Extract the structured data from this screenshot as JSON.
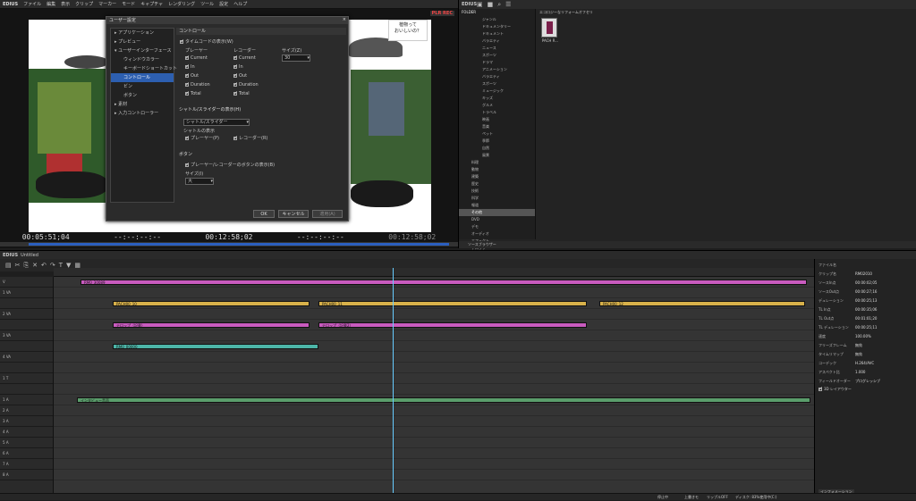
{
  "menu": {
    "brand": "EDIUS",
    "items": [
      "ファイル",
      "編集",
      "表示",
      "クリップ",
      "マーカー",
      "モード",
      "キャプチャ",
      "レンダリング",
      "ツール",
      "設定",
      "ヘルプ"
    ],
    "plrec": "PLR REC"
  },
  "preview": {
    "tc_left": "00:05:51;04",
    "tc_mid1": "--:--:--:--",
    "tc_mid2": "00:12:58;02",
    "tc_mid3": "--:--:--:--",
    "tc_right": "00:12:58;02",
    "logo_line1": "植物って",
    "logo_line2": "おいしいの？"
  },
  "transport": [
    "⏮",
    "■",
    "◀◀",
    "◀",
    "▶",
    "▶",
    "▶▶",
    "⏭"
  ],
  "dialog": {
    "title": "ユーザー設定",
    "close": "×",
    "tree": [
      {
        "label": "▸ アプリケーション",
        "sub": false,
        "sel": false
      },
      {
        "label": "▸ プレビュー",
        "sub": false,
        "sel": false
      },
      {
        "label": "▾ ユーザーインターフェース",
        "sub": false,
        "sel": false
      },
      {
        "label": "ウィンドウカラー",
        "sub": true,
        "sel": false
      },
      {
        "label": "キーボードショートカット",
        "sub": true,
        "sel": false
      },
      {
        "label": "コントロール",
        "sub": true,
        "sel": true
      },
      {
        "label": "ビン",
        "sub": true,
        "sel": false
      },
      {
        "label": "ボタン",
        "sub": true,
        "sel": false
      },
      {
        "label": "▸ 素材",
        "sub": false,
        "sel": false
      },
      {
        "label": "▸ 入力コントローラー",
        "sub": false,
        "sel": false
      }
    ],
    "panel_title": "コントロール",
    "tc_display": "タイムコードの表示(W)",
    "player_head": "プレーヤー",
    "recorder_head": "レコーダー",
    "size_head": "サイズ(Z)",
    "size_value": "30",
    "opts": [
      "Current",
      "In",
      "Out",
      "Duration",
      "Total"
    ],
    "shuttle_head": "シャトル/スライダーの表示(H)",
    "shuttle_value": "シャトル/スライダー",
    "shuttle_show": "シャトルの表示",
    "shuttle_player": "プレーヤー(P)",
    "shuttle_recorder": "レコーダー(R)",
    "button_head": "ボタン",
    "button_opt": "プレーヤー/レコーダーのボタンの表示(B)",
    "button_size_label": "サイズ(I)",
    "button_size_value": "大",
    "ok": "OK",
    "cancel": "キャンセル",
    "apply": "適用(A)"
  },
  "bin": {
    "title": "EDIUS",
    "folder_title": "FOLDER",
    "path": "エコロジーなリフォームオフセリ",
    "clip_label": "PACH R...",
    "folders": [
      "ジャンル",
      "ドキュメンタリー",
      "ドキュメント",
      "バラエティ",
      "ニュース",
      "スポーツ",
      "ドラマ",
      "アニメーション",
      "バラエティ",
      "スポーツ",
      "ミュージック",
      "キッズ",
      "グルメ",
      "トラベル",
      "映画",
      "音楽",
      "ペット",
      "季節",
      "自然",
      "風景",
      "料理",
      "動物",
      "建築",
      "歴史",
      "技術",
      "科学",
      "報道",
      "その他",
      "DVD",
      "デモ",
      "オーディオ",
      "エフェクト",
      "テロップ",
      "ポスター",
      "プロジェクト"
    ],
    "bottom": "ソースブラウザー"
  },
  "timeline": {
    "title": "EDIUS",
    "seq": "Untitled",
    "tab": "シーケンス1"
  },
  "tracks": [
    "V",
    "1 VA",
    "",
    "2 VA",
    "",
    "3 VA",
    "",
    "4 VA",
    "",
    "1 T",
    "",
    "1 A",
    "2 A",
    "3 A",
    "4 A",
    "5 A",
    "6 A",
    "7 A",
    "8 A"
  ],
  "clips": [
    {
      "label": "RM0_30089",
      "color": "#c95bbf"
    },
    {
      "label": "PACH00_10",
      "color": "#d8b14a"
    },
    {
      "label": "PACH00_11",
      "color": "#d8b14a"
    },
    {
      "label": "PACH00_12",
      "color": "#d8b14a"
    },
    {
      "label": "テロップ（記載）",
      "color": "#c95bbf"
    },
    {
      "label": "テロップ（記載2）",
      "color": "#c95bbf"
    },
    {
      "label": "RM0_00000",
      "color": "#4cb5a8"
    },
    {
      "label": "インタビュー音声",
      "color": "#5a9d6b"
    }
  ],
  "props": {
    "rows": [
      {
        "k": "ファイル名",
        "v": ""
      },
      {
        "k": "クリップ名",
        "v": "RM02010"
      },
      {
        "k": "ソースIn点",
        "v": "00:00:02;05"
      },
      {
        "k": "ソースOut点",
        "v": "00:00:27;16"
      },
      {
        "k": "デュレーション",
        "v": "00:00:25;13"
      },
      {
        "k": "TL In点",
        "v": "00:00:35;06"
      },
      {
        "k": "TL Out点",
        "v": "00:01:01;20"
      },
      {
        "k": "TL デュレーション",
        "v": "00:00:25;11"
      },
      {
        "k": "速度",
        "v": "100.00%"
      },
      {
        "k": "フリーズフレーム",
        "v": "無効"
      },
      {
        "k": "タイムリマップ",
        "v": "無効"
      },
      {
        "k": "コーデック",
        "v": "H.264/AVC"
      },
      {
        "k": "アスペクト比",
        "v": "1.000"
      },
      {
        "k": "フィールドオーダー",
        "v": "プログレッシブ"
      }
    ],
    "layer": "3D レイアウター",
    "footer": "インフォメーション"
  },
  "status": {
    "mode": "停止中",
    "overwrite": "上書きモ",
    "ripple": "リップルOFF",
    "disk": "ディスク: 83%使用中(C:)"
  }
}
